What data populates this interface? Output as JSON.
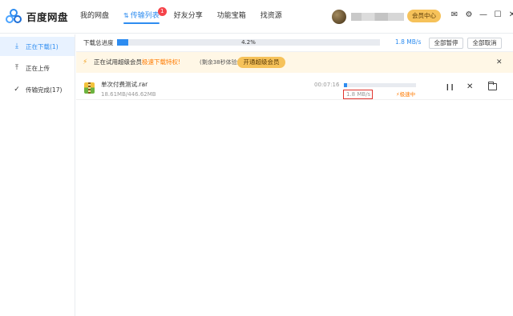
{
  "app": {
    "name": "百度网盘"
  },
  "nav": {
    "items": [
      {
        "label": "我的网盘"
      },
      {
        "label": "传输列表",
        "active": true,
        "badge": "1"
      },
      {
        "label": "好友分享"
      },
      {
        "label": "功能宝箱"
      },
      {
        "label": "找资源"
      }
    ]
  },
  "header": {
    "vip_center": "会员中心",
    "icons": [
      "mail-icon",
      "settings-icon",
      "minimize-icon",
      "maximize-icon",
      "close-icon"
    ]
  },
  "sidebar": {
    "items": [
      {
        "label": "正在下载(1)",
        "icon": "download-icon",
        "active": true
      },
      {
        "label": "正在上传",
        "icon": "upload-icon"
      },
      {
        "label": "传输完成(17)",
        "icon": "check-circle-icon"
      }
    ]
  },
  "summary": {
    "label": "下载总进度",
    "progress_text": "4.2%",
    "progress": 0.042,
    "speed": "1.8 MB/s",
    "pause_all": "全部暂停",
    "cancel_all": "全部取消"
  },
  "banner": {
    "text_prefix": "正在试用超级会员",
    "text_highlight": "极速下载特权!",
    "sub": "(剩余38秒体验结束)",
    "button": "开通超级会员"
  },
  "downloads": [
    {
      "name": "单次付费测试.rar",
      "size": "18.61MB/446.62MB",
      "time_left": "00:07:16",
      "progress": 0.042,
      "speed": "1.8 MB/s",
      "accel": "极速中"
    }
  ],
  "colors": {
    "accent": "#2d8cf0",
    "vip": "#f6c25a",
    "banner_bg": "#fff7e6",
    "highlight": "#ff7a00",
    "badge": "#f5434a"
  }
}
